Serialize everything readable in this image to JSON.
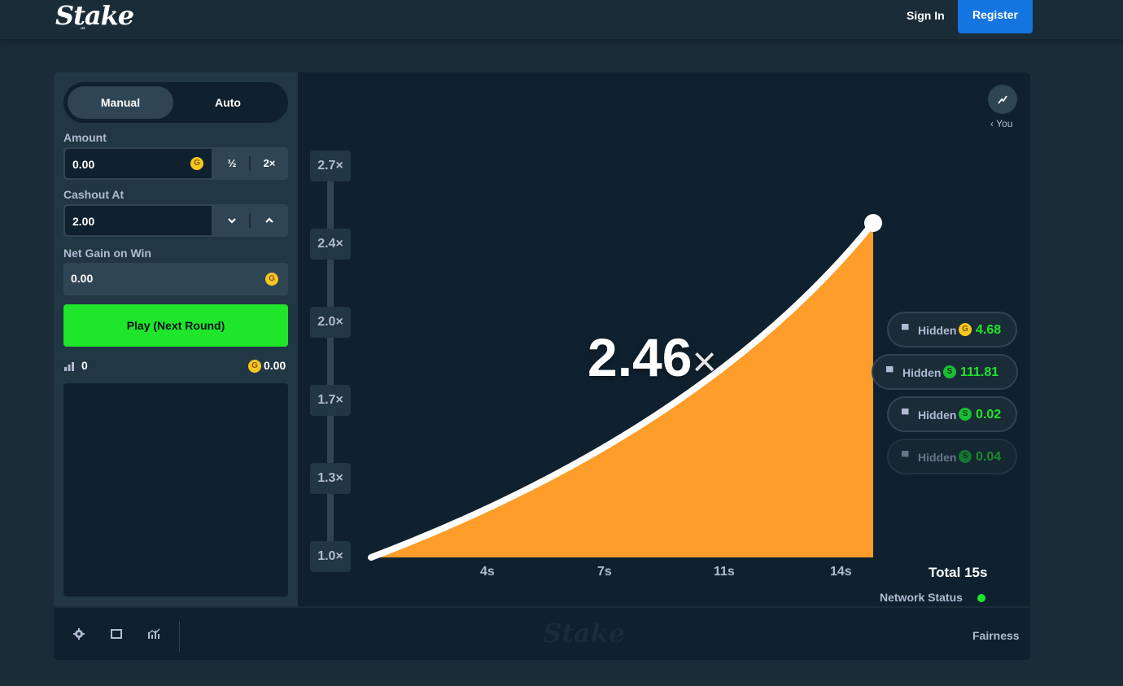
{
  "header": {
    "logo_text": "Stake",
    "logo_sub": ".us",
    "signin_label": "Sign In",
    "register_label": "Register"
  },
  "sidebar": {
    "tabs": [
      {
        "label": "Manual"
      },
      {
        "label": "Auto"
      }
    ],
    "amount_label": "Amount",
    "amount_value": "0.00",
    "half_label": "½",
    "double_label": "2×",
    "cashout_label": "Cashout At",
    "cashout_value": "2.00",
    "netgain_label": "Net Gain on Win",
    "netgain_value": "0.00",
    "play_label": "Play (Next Round)",
    "players_count": "0",
    "total_bet": "0.00",
    "coin_g": "G"
  },
  "chart": {
    "multiplier": "2.46",
    "multiplier_suffix": "×",
    "you_label": "‹ You",
    "y_ticks": [
      "2.7×",
      "2.4×",
      "2.0×",
      "1.7×",
      "1.3×",
      "1.0×"
    ],
    "x_ticks": [
      "4s",
      "7s",
      "11s",
      "14s"
    ],
    "total_label": "Total 15s",
    "network_label": "Network Status",
    "curve_color": "#ff9d2a",
    "players": [
      {
        "name": "Hidden",
        "coin": "G",
        "amount": "4.68"
      },
      {
        "name": "Hidden",
        "coin": "S",
        "amount": "111.81"
      },
      {
        "name": "Hidden",
        "coin": "S",
        "amount": "0.02"
      },
      {
        "name": "Hidden",
        "coin": "S",
        "amount": "0.04"
      }
    ]
  },
  "footer": {
    "fairness_label": "Fairness",
    "watermark": "Stake"
  }
}
